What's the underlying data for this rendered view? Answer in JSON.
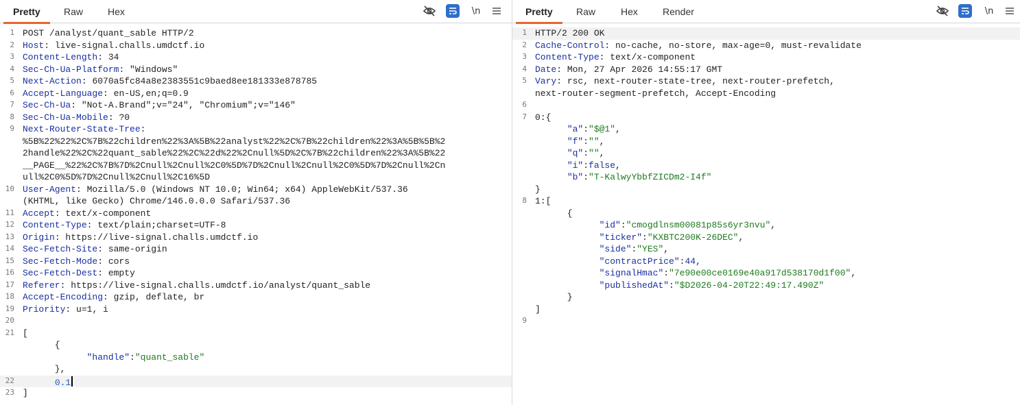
{
  "request": {
    "tabs": [
      "Pretty",
      "Raw",
      "Hex"
    ],
    "active_tab": "Pretty",
    "newline_toggle": "\\n",
    "lines": [
      {
        "n": "1",
        "key": "",
        "text": "POST /analyst/quant_sable HTTP/2"
      },
      {
        "n": "2",
        "key": "Host",
        "text": " live-signal.challs.umdctf.io"
      },
      {
        "n": "3",
        "key": "Content-Length",
        "text": " 34"
      },
      {
        "n": "4",
        "key": "Sec-Ch-Ua-Platform",
        "text": " \"Windows\""
      },
      {
        "n": "5",
        "key": "Next-Action",
        "text": " 6070a5fc84a8e2383551c9baed8ee181333e878785"
      },
      {
        "n": "6",
        "key": "Accept-Language",
        "text": " en-US,en;q=0.9"
      },
      {
        "n": "7",
        "key": "Sec-Ch-Ua",
        "text": " \"Not-A.Brand\";v=\"24\", \"Chromium\";v=\"146\""
      },
      {
        "n": "8",
        "key": "Sec-Ch-Ua-Mobile",
        "text": " ?0"
      },
      {
        "n": "9",
        "key": "Next-Router-State-Tree",
        "text": ""
      },
      {
        "n": "",
        "key": "",
        "text": "%5B%22%22%2C%7B%22children%22%3A%5B%22analyst%22%2C%7B%22children%22%3A%5B%5B%2"
      },
      {
        "n": "",
        "key": "",
        "text": "2handle%22%2C%22quant_sable%22%2C%22d%22%2Cnull%5D%2C%7B%22children%22%3A%5B%22"
      },
      {
        "n": "",
        "key": "",
        "text": "__PAGE__%22%2C%7B%7D%2Cnull%2Cnull%2C0%5D%7D%2Cnull%2Cnull%2C0%5D%7D%2Cnull%2Cn"
      },
      {
        "n": "",
        "key": "",
        "text": "ull%2C0%5D%7D%2Cnull%2Cnull%2C16%5D"
      },
      {
        "n": "10",
        "key": "User-Agent",
        "text": " Mozilla/5.0 (Windows NT 10.0; Win64; x64) AppleWebKit/537.36"
      },
      {
        "n": "",
        "key": "",
        "text": "(KHTML, like Gecko) Chrome/146.0.0.0 Safari/537.36"
      },
      {
        "n": "11",
        "key": "Accept",
        "text": " text/x-component"
      },
      {
        "n": "12",
        "key": "Content-Type",
        "text": " text/plain;charset=UTF-8"
      },
      {
        "n": "13",
        "key": "Origin",
        "text": " https://live-signal.challs.umdctf.io"
      },
      {
        "n": "14",
        "key": "Sec-Fetch-Site",
        "text": " same-origin"
      },
      {
        "n": "15",
        "key": "Sec-Fetch-Mode",
        "text": " cors"
      },
      {
        "n": "16",
        "key": "Sec-Fetch-Dest",
        "text": " empty"
      },
      {
        "n": "17",
        "key": "Referer",
        "text": " https://live-signal.challs.umdctf.io/analyst/quant_sable"
      },
      {
        "n": "18",
        "key": "Accept-Encoding",
        "text": " gzip, deflate, br"
      },
      {
        "n": "19",
        "key": "Priority",
        "text": " u=1, i"
      },
      {
        "n": "20",
        "key": "",
        "text": ""
      },
      {
        "n": "21",
        "key": "",
        "text": "["
      },
      {
        "n": "",
        "key": "",
        "text": "      {"
      },
      {
        "n": "",
        "key": "",
        "text": "            ",
        "jkey": "\"handle\"",
        "jval": "\"quant_sable\""
      },
      {
        "n": "",
        "key": "",
        "text": "      },"
      },
      {
        "n": "22",
        "key": "",
        "text": "      ",
        "num": "0.1",
        "caret": true
      },
      {
        "n": "23",
        "key": "",
        "text": "]"
      }
    ]
  },
  "response": {
    "tabs": [
      "Pretty",
      "Raw",
      "Hex",
      "Render"
    ],
    "active_tab": "Pretty",
    "newline_toggle": "\\n",
    "lines": [
      {
        "n": "1",
        "key": "",
        "text": "HTTP/2 200 OK"
      },
      {
        "n": "2",
        "key": "Cache-Control",
        "text": " no-cache, no-store, max-age=0, must-revalidate"
      },
      {
        "n": "3",
        "key": "Content-Type",
        "text": " text/x-component"
      },
      {
        "n": "4",
        "key": "Date",
        "text": " Mon, 27 Apr 2026 14:55:17 GMT"
      },
      {
        "n": "5",
        "key": "Vary",
        "text": " rsc, next-router-state-tree, next-router-prefetch,"
      },
      {
        "n": "",
        "key": "",
        "text": "next-router-segment-prefetch, Accept-Encoding"
      },
      {
        "n": "6",
        "key": "",
        "text": ""
      },
      {
        "n": "7",
        "key": "",
        "text": "0:{"
      },
      {
        "n": "",
        "key": "",
        "text": "      ",
        "jkey": "\"a\"",
        "jval": "\"$@1\"",
        "tail": ","
      },
      {
        "n": "",
        "key": "",
        "text": "      ",
        "jkey": "\"f\"",
        "jval": "\"\"",
        "tail": ","
      },
      {
        "n": "",
        "key": "",
        "text": "      ",
        "jkey": "\"q\"",
        "jval": "\"\"",
        "tail": ","
      },
      {
        "n": "",
        "key": "",
        "text": "      ",
        "jkey": "\"i\"",
        "jlit": "false",
        "tail": ","
      },
      {
        "n": "",
        "key": "",
        "text": "      ",
        "jkey": "\"b\"",
        "jval": "\"T-KalwyYbbfZICDm2-I4f\""
      },
      {
        "n": "",
        "key": "",
        "text": "}"
      },
      {
        "n": "8",
        "key": "",
        "text": "1:["
      },
      {
        "n": "",
        "key": "",
        "text": "      {"
      },
      {
        "n": "",
        "key": "",
        "text": "            ",
        "jkey": "\"id\"",
        "jval": "\"cmogdlnsm00081p85s6yr3nvu\"",
        "tail": ","
      },
      {
        "n": "",
        "key": "",
        "text": "            ",
        "jkey": "\"ticker\"",
        "jval": "\"KXBTC200K-26DEC\"",
        "tail": ","
      },
      {
        "n": "",
        "key": "",
        "text": "            ",
        "jkey": "\"side\"",
        "jval": "\"YES\"",
        "tail": ","
      },
      {
        "n": "",
        "key": "",
        "text": "            ",
        "jkey": "\"contractPrice\"",
        "jnum": "44",
        "tail": ","
      },
      {
        "n": "",
        "key": "",
        "text": "            ",
        "jkey": "\"signalHmac\"",
        "jval": "\"7e90e00ce0169e40a917d538170d1f00\"",
        "tail": ","
      },
      {
        "n": "",
        "key": "",
        "text": "            ",
        "jkey": "\"publishedAt\"",
        "jval": "\"$D2026-04-20T22:49:17.490Z\""
      },
      {
        "n": "",
        "key": "",
        "text": "      }"
      },
      {
        "n": "",
        "key": "",
        "text": "]"
      },
      {
        "n": "9",
        "key": "",
        "text": ""
      }
    ]
  }
}
